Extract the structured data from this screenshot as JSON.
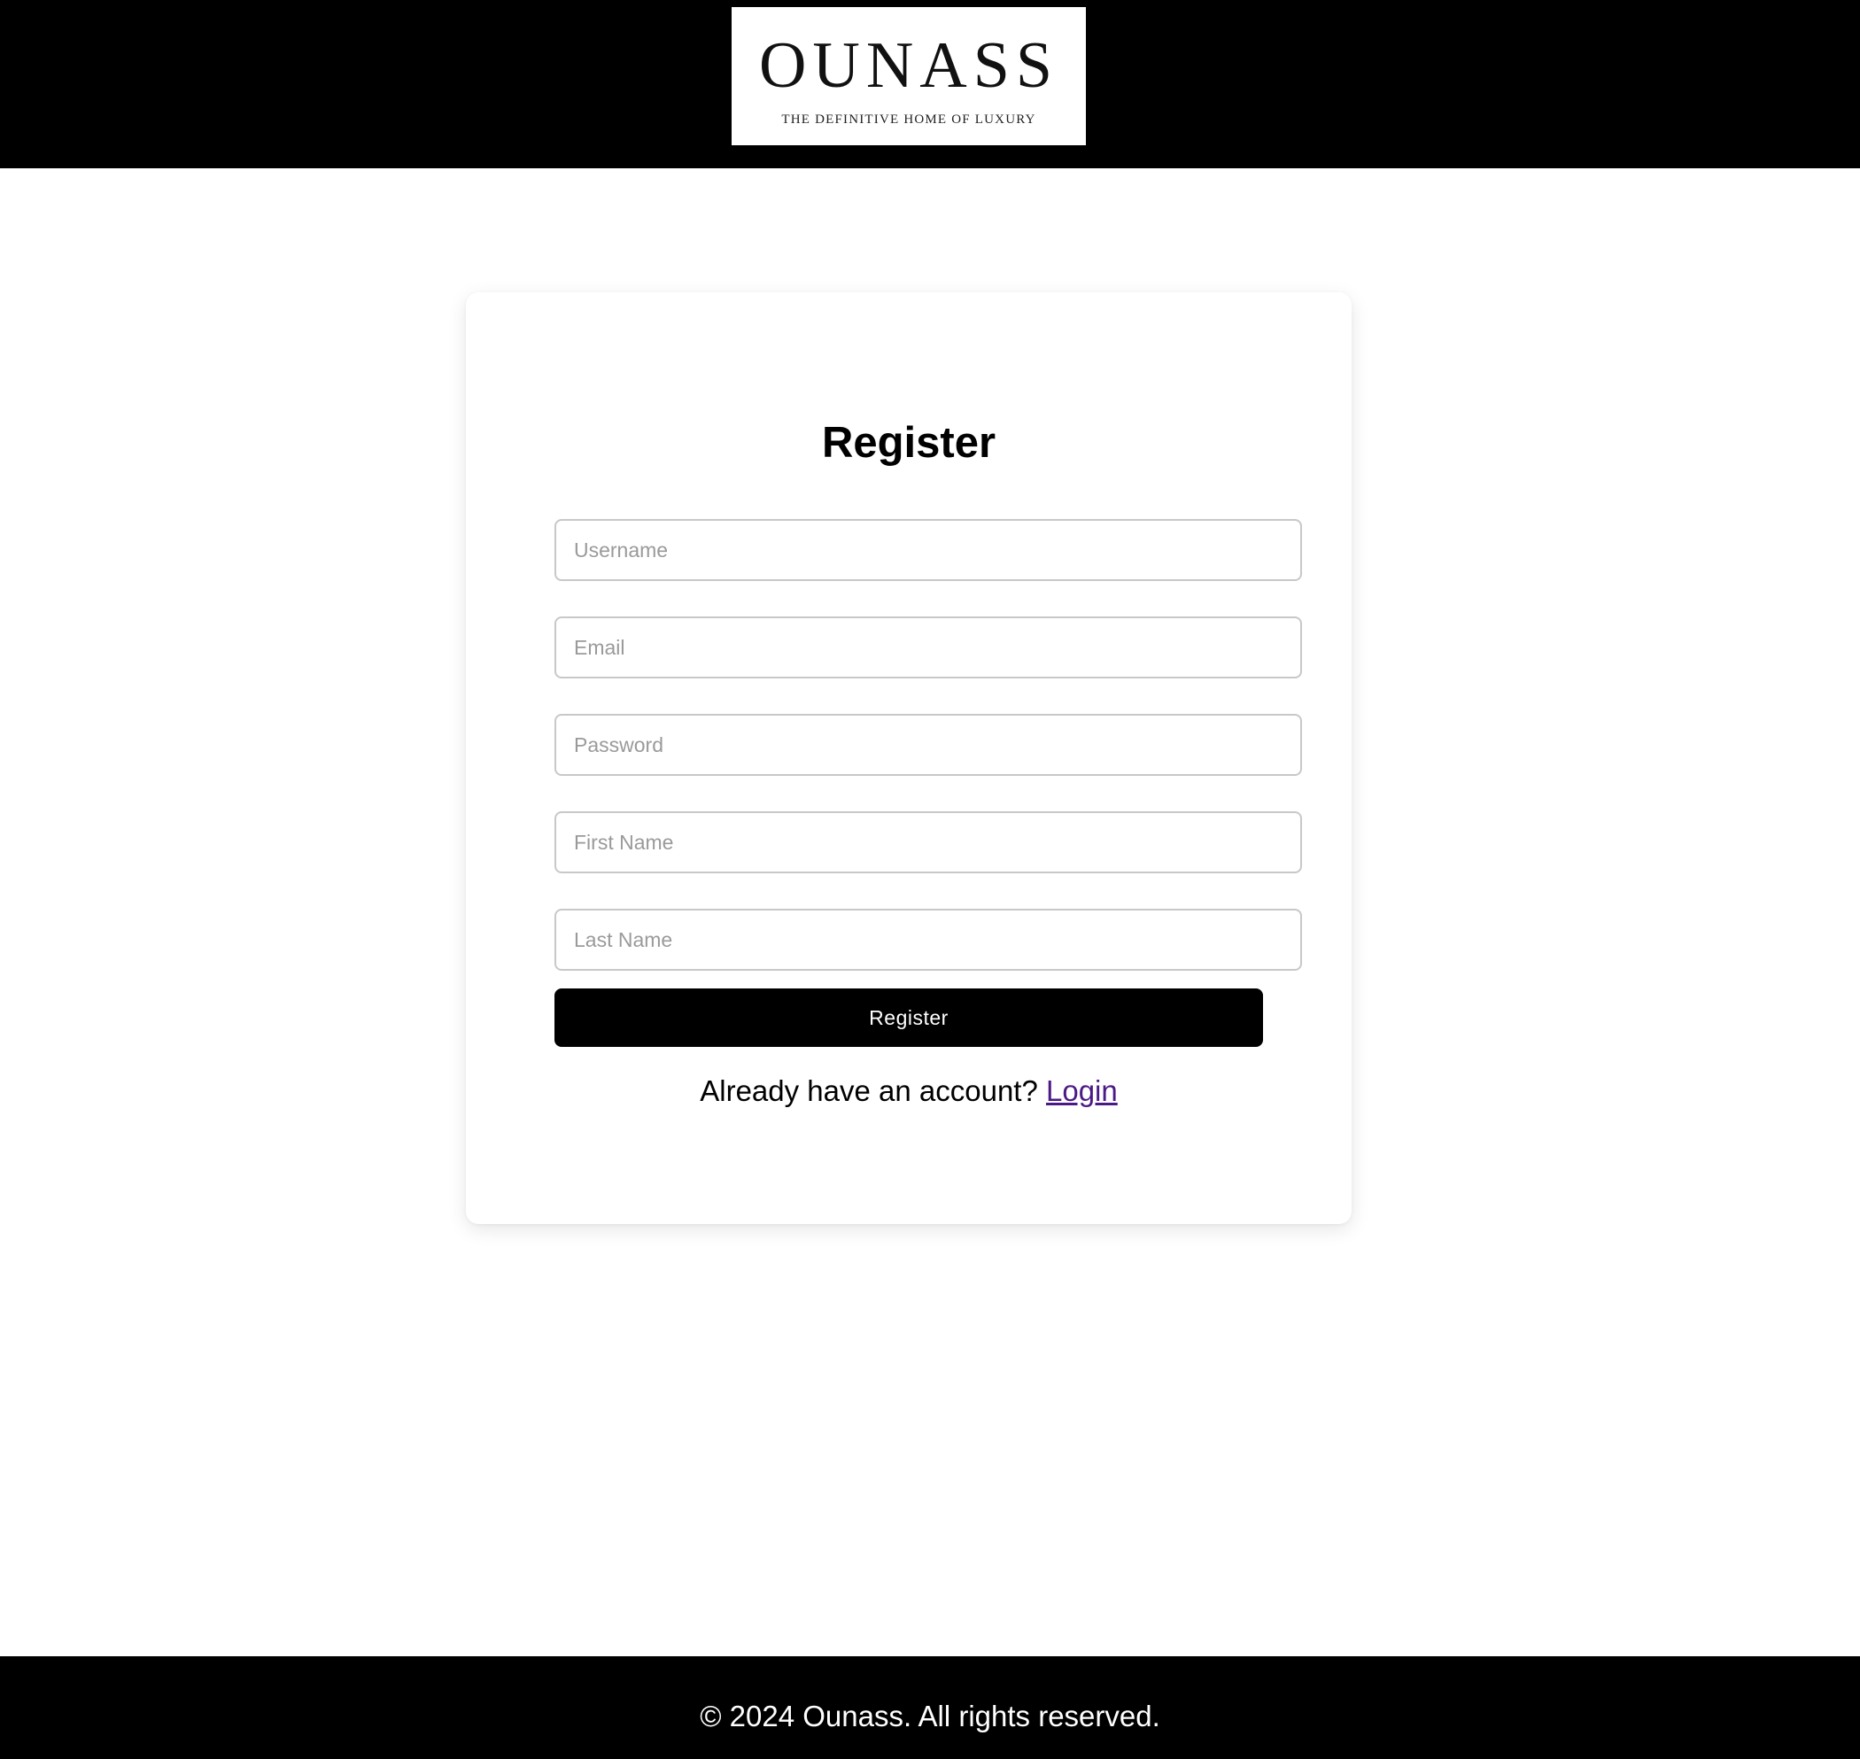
{
  "header": {
    "logo": {
      "wordmark": "OUNASS",
      "tagline": "THE DEFINITIVE HOME OF LUXURY"
    }
  },
  "register_form": {
    "title": "Register",
    "fields": {
      "username": {
        "placeholder": "Username",
        "value": ""
      },
      "email": {
        "placeholder": "Email",
        "value": ""
      },
      "password": {
        "placeholder": "Password",
        "value": ""
      },
      "first_name": {
        "placeholder": "First Name",
        "value": ""
      },
      "last_name": {
        "placeholder": "Last Name",
        "value": ""
      }
    },
    "submit_label": "Register",
    "login_prompt": "Already have an account?",
    "login_link": "Login"
  },
  "footer": {
    "copyright": "© 2024 Ounass. All rights reserved."
  },
  "colors": {
    "header_bg": "#000000",
    "footer_bg": "#000000",
    "button_bg": "#000000",
    "link": "#4b1a86"
  }
}
